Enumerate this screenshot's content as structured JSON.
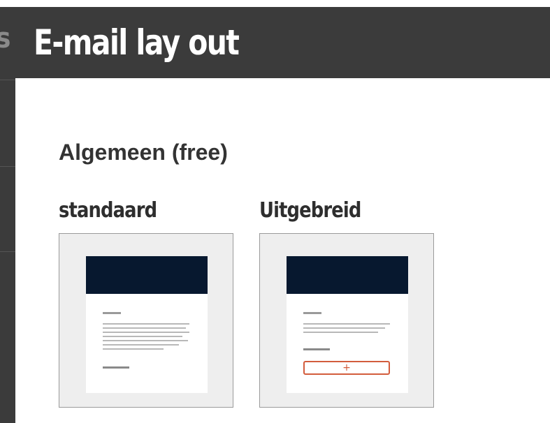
{
  "header": {
    "title": "E-mail lay out",
    "left_letter": "s"
  },
  "section": {
    "title": "Algemeen (free)"
  },
  "layouts": [
    {
      "label": "standaard"
    },
    {
      "label": "Uitgebreid",
      "add_icon": "+"
    }
  ],
  "colors": {
    "header_bg": "#3b3b3b",
    "thumb_banner": "#07182f",
    "accent": "#d35c3c"
  }
}
